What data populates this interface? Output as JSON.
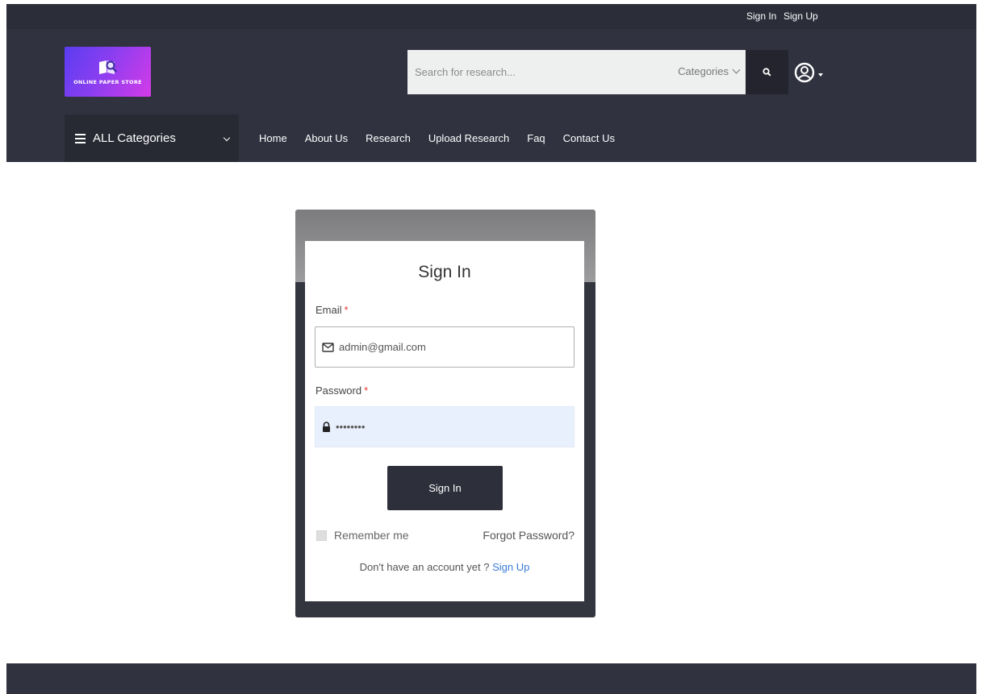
{
  "topbar": {
    "sign_in": "Sign In",
    "sign_up": "Sign Up"
  },
  "logo": {
    "text": "ONLINE PAPER STORE"
  },
  "search": {
    "placeholder": "Search for research...",
    "category_label": "Categories"
  },
  "nav": {
    "all_categories": "ALL Categories",
    "items": [
      "Home",
      "About Us",
      "Research",
      "Upload Research",
      "Faq",
      "Contact Us"
    ]
  },
  "signin_form": {
    "title": "Sign In",
    "email_label": "Email",
    "email_value": "admin@gmail.com",
    "password_label": "Password",
    "password_value": "••••••••",
    "required_marker": "*",
    "submit_label": "Sign In",
    "remember_label": "Remember me",
    "forgot_label": "Forgot Password?",
    "no_account_text": "Don't have an account yet ?",
    "signup_link": "Sign Up"
  },
  "colors": {
    "header_bg": "#30323f",
    "topbar_bg": "#2b2d39",
    "button_bg": "#2d2f3a",
    "link": "#3a7bd5",
    "required": "#e53935"
  }
}
